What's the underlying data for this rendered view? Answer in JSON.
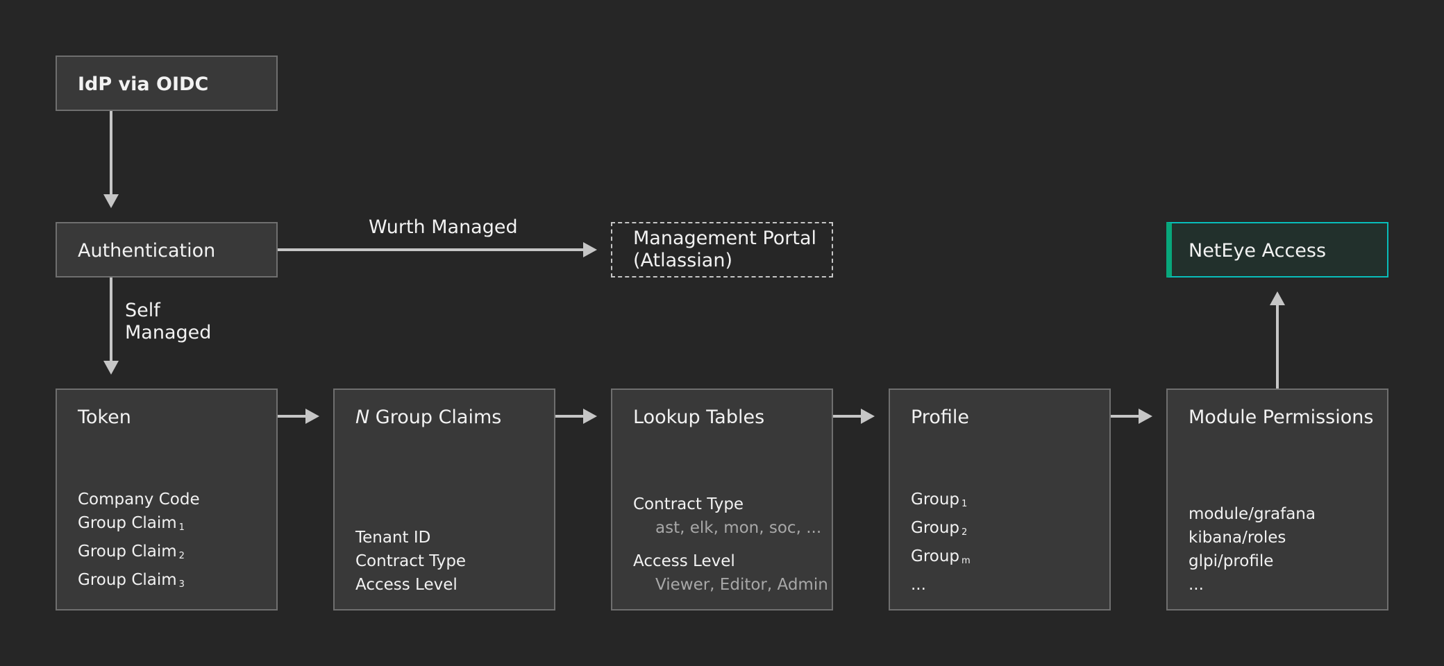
{
  "nodes": {
    "idp": {
      "title": "IdP via OIDC"
    },
    "authentication": {
      "title": "Authentication"
    },
    "management_portal": {
      "line1": "Management Portal",
      "line2": "(Atlassian)"
    },
    "neteye_access": {
      "title": "NetEye Access"
    },
    "token": {
      "title": "Token",
      "items": [
        {
          "text": "Company Code",
          "sub": ""
        },
        {
          "text": "Group Claim",
          "sub": "1"
        },
        {
          "text": "Group Claim",
          "sub": "2"
        },
        {
          "text": "Group Claim",
          "sub": "3"
        }
      ]
    },
    "group_claims": {
      "title_prefix": "N",
      "title": " Group Claims",
      "items": [
        "Tenant ID",
        "Contract Type",
        "Access Level"
      ]
    },
    "lookup_tables": {
      "title": "Lookup Tables",
      "entries": [
        {
          "label": "Contract Type",
          "values": "ast, elk, mon, soc, ..."
        },
        {
          "label": "Access Level",
          "values": "Viewer, Editor, Admin"
        }
      ]
    },
    "profile": {
      "title": "Profile",
      "items": [
        {
          "text": "Group",
          "sub": "1"
        },
        {
          "text": "Group",
          "sub": "2"
        },
        {
          "text": "Group",
          "sub": "m"
        },
        {
          "text": "...",
          "sub": ""
        }
      ]
    },
    "module_permissions": {
      "title": "Module Permissions",
      "items": [
        "module/grafana",
        "kibana/roles",
        "glpi/profile",
        "..."
      ]
    }
  },
  "edges": {
    "wurth_managed": "Wurth Managed",
    "self_managed_line1": "Self",
    "self_managed_line2": "Managed"
  },
  "colors": {
    "background": "#262626",
    "box_fill": "#393939",
    "box_border": "#6f6f6f",
    "arrow": "#c6c6c6",
    "accent": "#08bdba",
    "muted_text": "#a8a8a8"
  }
}
